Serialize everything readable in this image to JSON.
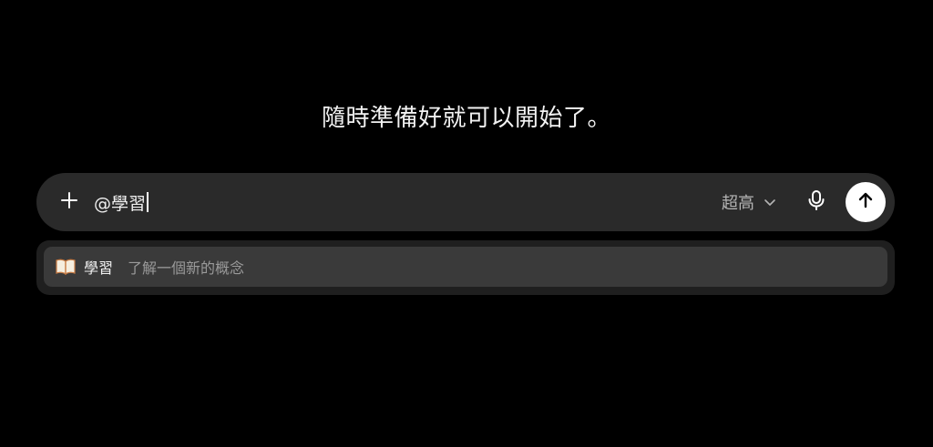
{
  "main": {
    "heading": "隨時準備好就可以開始了。"
  },
  "composer": {
    "input_value": "@學習",
    "model_label": "超高",
    "plus_icon": "plus-icon",
    "chevron_icon": "chevron-down-icon",
    "mic_icon": "microphone-icon",
    "send_icon": "arrow-up-icon"
  },
  "suggestions": {
    "items": [
      {
        "icon": "book-icon",
        "label": "學習",
        "description": "了解一個新的概念"
      }
    ]
  },
  "colors": {
    "background": "#000000",
    "composer_bg": "#2a2a2a",
    "suggestion_panel_bg": "#1f1f1f",
    "suggestion_item_bg": "#3a3a3a",
    "send_button_bg": "#ffffff"
  }
}
